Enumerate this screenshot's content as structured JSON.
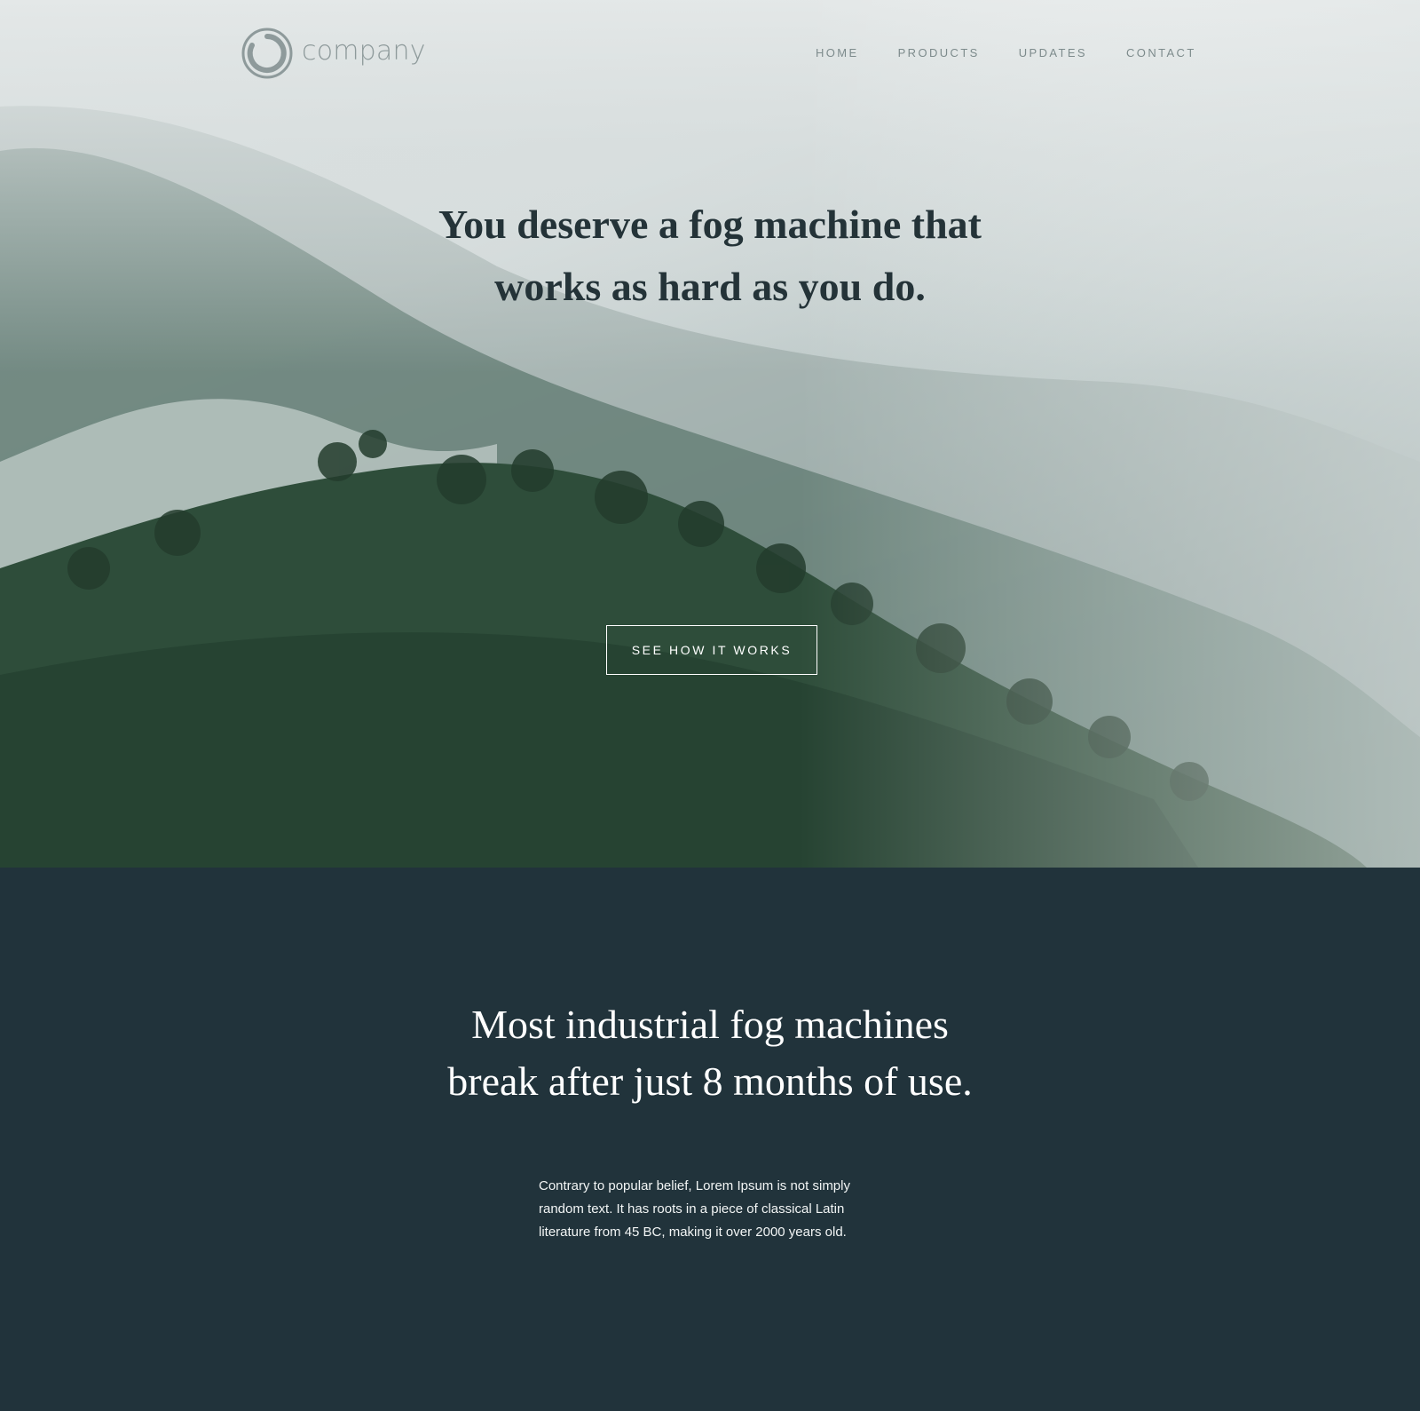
{
  "brand": {
    "name": "company"
  },
  "nav": {
    "items": [
      {
        "label": "HOME"
      },
      {
        "label": "PRODUCTS"
      },
      {
        "label": "UPDATES"
      },
      {
        "label": "CONTACT"
      }
    ]
  },
  "hero": {
    "title_line1": "You deserve a fog machine that",
    "title_line2": "works as hard as you do.",
    "cta_label": "SEE HOW IT WORKS"
  },
  "info": {
    "title_line1": "Most industrial fog machines",
    "title_line2": "break after just 8 months of use.",
    "body_line1": "Contrary to popular belief, Lorem Ipsum is not simply",
    "body_line2": "random text. It has roots in a piece of classical Latin",
    "body_line3": "literature from 45 BC, making it over 2000 years old."
  },
  "colors": {
    "dark_section": "#21333b",
    "heading_dark": "#243338",
    "nav_text": "#7d8b8c",
    "forest_dark": "#2a4a37"
  }
}
